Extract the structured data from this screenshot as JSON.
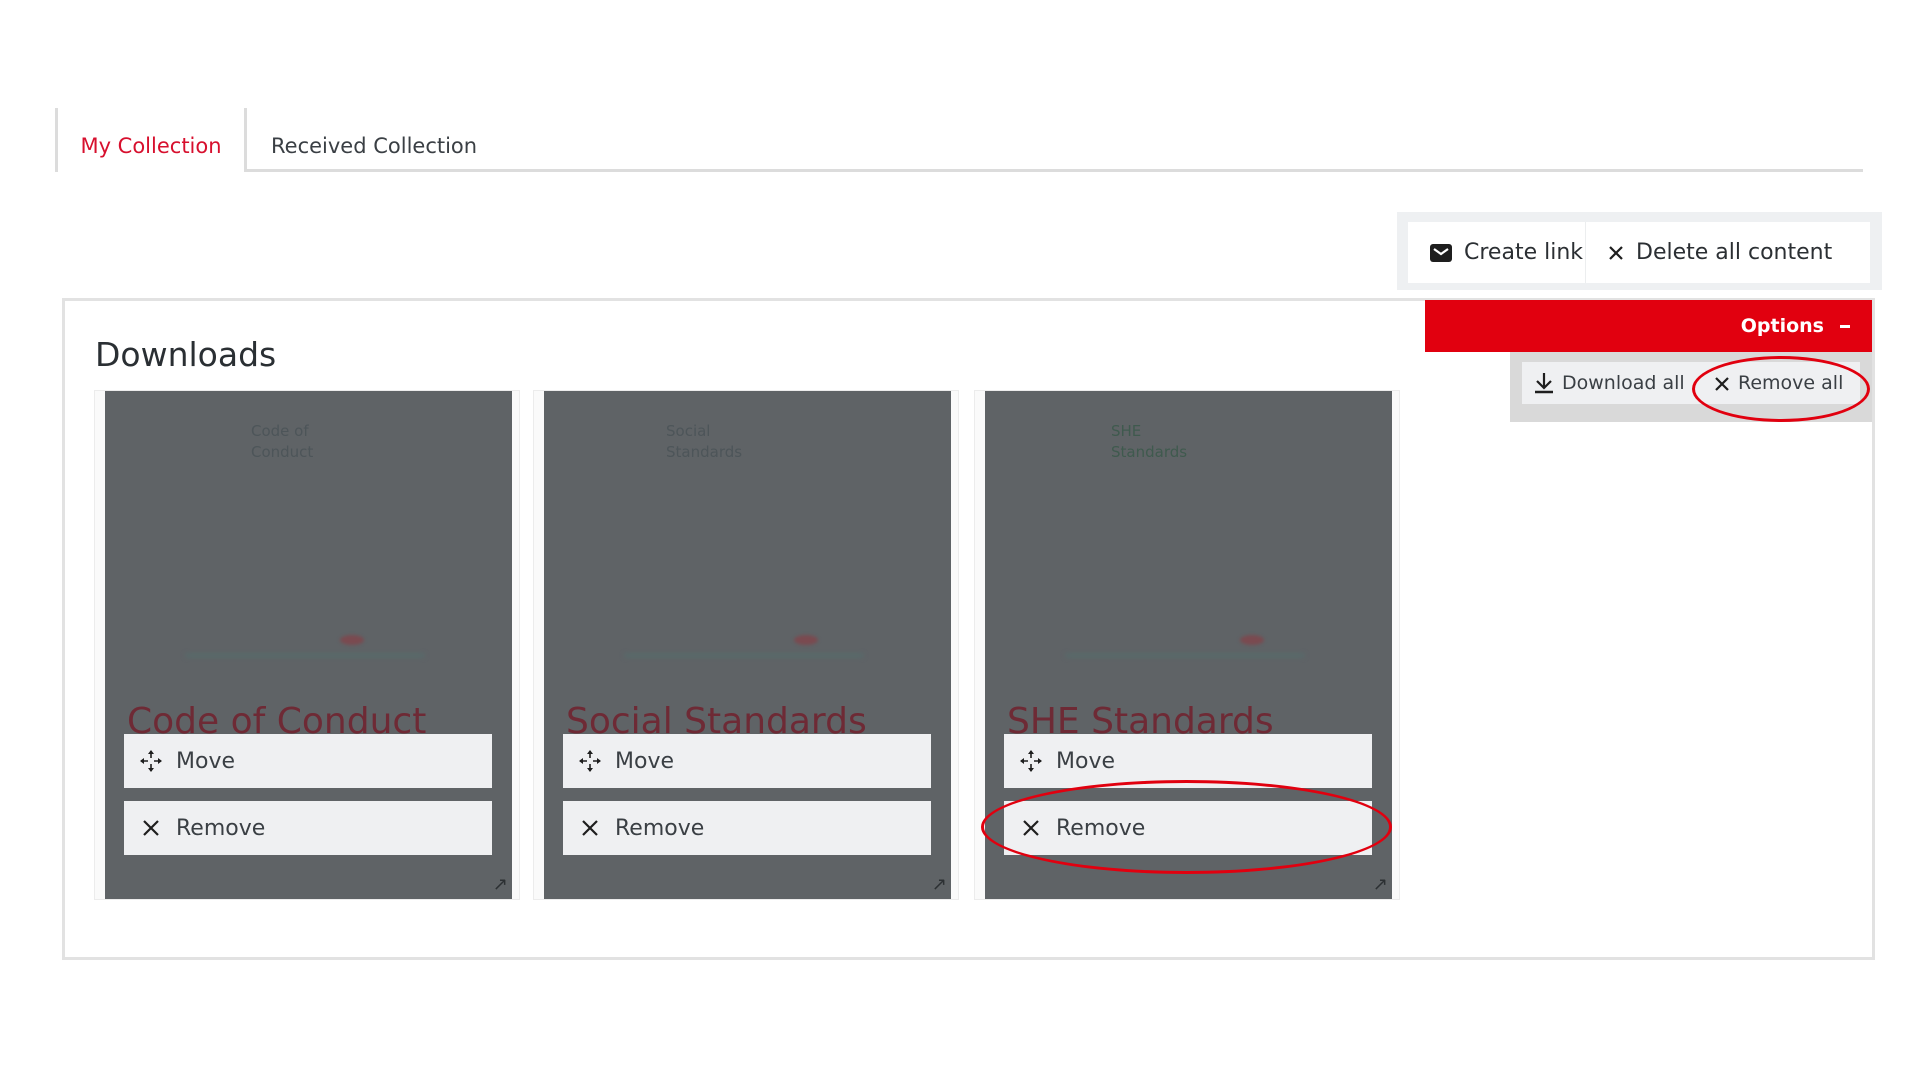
{
  "tabs": [
    {
      "label": "My Collection",
      "active": true
    },
    {
      "label": "Received Collection",
      "active": false
    }
  ],
  "toolbar": {
    "create_link_label": "Create link",
    "create_link_icon": "envelope-icon",
    "delete_all_label": "Delete all content",
    "delete_all_icon": "close-icon"
  },
  "panel": {
    "title": "Downloads"
  },
  "options": {
    "label": "Options",
    "toggle_icon": "minus-icon",
    "download_all_label": "Download all",
    "download_all_icon": "download-icon",
    "remove_all_label": "Remove all",
    "remove_all_icon": "close-icon"
  },
  "cards": [
    {
      "cover_title": "Code of\nConduct",
      "name": "Code of Conduct",
      "move_label": "Move",
      "remove_label": "Remove"
    },
    {
      "cover_title": "Social\nStandards",
      "name": "Social Standards",
      "move_label": "Move",
      "remove_label": "Remove"
    },
    {
      "cover_title": "SHE\nStandards",
      "name": "SHE Standards",
      "move_label": "Move",
      "remove_label": "Remove"
    }
  ],
  "annotations": {
    "highlight_color": "#e1000f",
    "highlighted": [
      "remove-all-button",
      "card-3-remove-button"
    ]
  },
  "colors": {
    "accent": "#e1000f",
    "active_tab_text": "#d7102e",
    "card_overlay": "#5f6366"
  }
}
